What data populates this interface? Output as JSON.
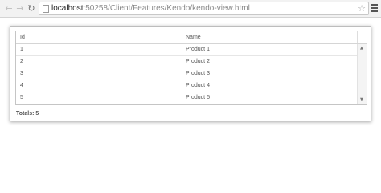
{
  "browser": {
    "url_host": "localhost",
    "url_path": ":50258/Client/Features/Kendo/kendo-view.html"
  },
  "grid": {
    "columns": [
      "Id",
      "Name"
    ],
    "rows": [
      {
        "id": "1",
        "name": "Product 1"
      },
      {
        "id": "2",
        "name": "Product 2"
      },
      {
        "id": "3",
        "name": "Product 3"
      },
      {
        "id": "4",
        "name": "Product 4"
      },
      {
        "id": "5",
        "name": "Product 5"
      }
    ]
  },
  "footer": {
    "totals": "Totals: 5"
  },
  "icons": {
    "back": "back-arrow-icon",
    "forward": "forward-arrow-icon",
    "reload": "reload-icon",
    "page": "page-icon",
    "bookmark": "star-icon",
    "menu": "hamburger-menu-icon"
  }
}
